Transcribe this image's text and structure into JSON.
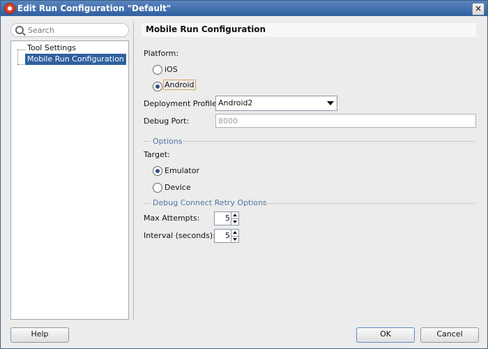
{
  "window": {
    "title": "Edit Run Configuration \"Default\"",
    "close_symbol": "×"
  },
  "sidebar": {
    "search_placeholder": "Search",
    "items": [
      {
        "label": "Tool Settings"
      },
      {
        "label": "Mobile Run Configuration"
      }
    ]
  },
  "main": {
    "header_title": "Mobile Run Configuration",
    "platform_label": "Platform:",
    "platform_options": [
      {
        "label": "iOS"
      },
      {
        "label": "Android"
      }
    ],
    "deployment_profile_label": "Deployment Profile:",
    "deployment_profile_value": "Android2",
    "debug_port_label": "Debug Port:",
    "debug_port_value": "8000",
    "options_title": "Options",
    "target_label": "Target:",
    "target_options": [
      {
        "label": "Emulator"
      },
      {
        "label": "Device"
      }
    ],
    "retry_title": "Debug Connect Retry Options",
    "max_attempts_label": "Max Attempts:",
    "max_attempts_value": "5",
    "interval_label": "Interval (seconds):",
    "interval_value": "5"
  },
  "footer": {
    "help_label": "Help",
    "ok_label": "OK",
    "cancel_label": "Cancel"
  }
}
